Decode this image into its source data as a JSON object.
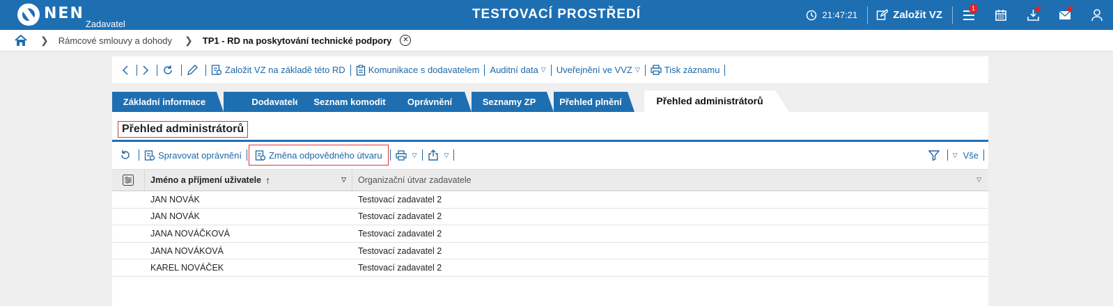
{
  "header": {
    "logo_text": "NEN",
    "role": "Zadavatel",
    "env_title": "TESTOVACÍ PROSTŘEDÍ",
    "time": "21:47:21",
    "create_vz": "Založit VZ",
    "menu_badge": "1",
    "colors": {
      "brand": "#1e6fb2",
      "badge": "#e02424"
    }
  },
  "breadcrumb": {
    "items": [
      "Rámcové smlouvy a dohody"
    ],
    "current": "TP1 - RD na poskytování technické podpory"
  },
  "toolbar": {
    "create_vz_from_rd": "Založit VZ na základě této RD",
    "communication": "Komunikace s dodavatelem",
    "audit_data": "Auditní data",
    "publication": "Uveřejnění ve VVZ",
    "print_record": "Tisk záznamu"
  },
  "tabs": [
    {
      "label": "Základní informace",
      "active": false
    },
    {
      "label": "Dodavatelé",
      "active": false
    },
    {
      "label": "Seznam komodit",
      "active": false
    },
    {
      "label": "Oprávnění",
      "active": false
    },
    {
      "label": "Seznamy ZP",
      "active": false
    },
    {
      "label": "Přehled plnění",
      "active": false
    },
    {
      "label": "Přehled administrátorů",
      "active": true
    }
  ],
  "panel": {
    "title": "Přehled administrátorů",
    "grid_toolbar": {
      "manage_permissions": "Spravovat oprávnění",
      "change_unit": "Změna odpovědného útvaru",
      "filter_all": "Vše"
    },
    "table": {
      "columns": [
        "Jméno a příjmení uživatele",
        "Organizační útvar zadavatele"
      ],
      "rows": [
        [
          "JAN NOVÁK",
          "Testovací zadavatel 2"
        ],
        [
          "JAN NOVÁK",
          "Testovací zadavatel 2"
        ],
        [
          "JANA NOVÁČKOVÁ",
          "Testovací zadavatel 2"
        ],
        [
          "JANA NOVÁKOVÁ",
          "Testovací zadavatel 2"
        ],
        [
          "KAREL NOVÁČEK",
          "Testovací zadavatel 2"
        ]
      ]
    }
  }
}
